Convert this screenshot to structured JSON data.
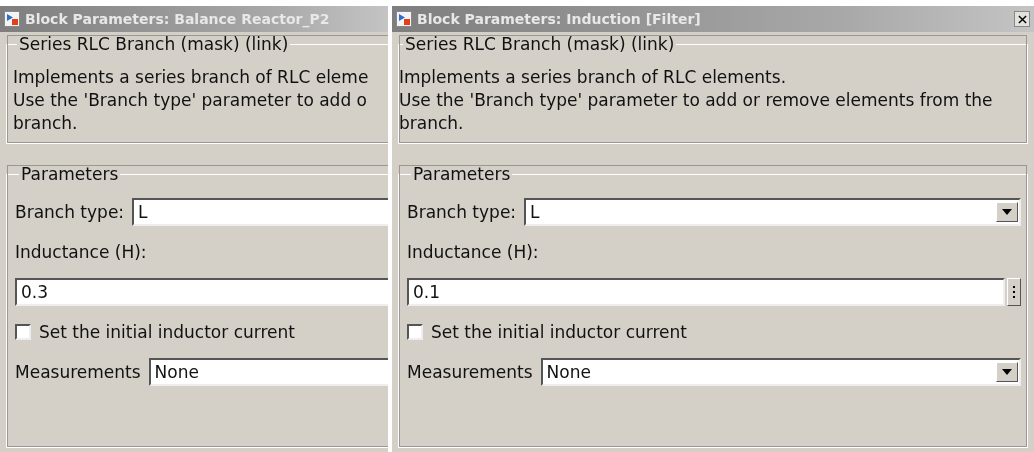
{
  "windows": [
    {
      "title": "Block Parameters: Balance Reactor_P2",
      "partly_covered": true,
      "closable": false,
      "mask_group": {
        "title": "Series RLC Branch (mask) (link)",
        "description": [
          "Implements a series branch of RLC eleme",
          "Use the 'Branch type' parameter to add o",
          "branch."
        ]
      },
      "parameters": {
        "title": "Parameters",
        "branch_type": {
          "label": "Branch type:",
          "value": "L"
        },
        "inductance": {
          "label": "Inductance (H):",
          "value": "0.3"
        },
        "initial_current": {
          "label": "Set the initial inductor current",
          "checked": false
        },
        "measurements": {
          "label": "Measurements",
          "value": "None"
        }
      }
    },
    {
      "title": "Block Parameters: Induction [Filter]",
      "partly_covered": false,
      "closable": true,
      "mask_group": {
        "title": "Series RLC Branch (mask) (link)",
        "description": [
          "Implements a series branch of RLC elements.",
          "Use the 'Branch type' parameter to add or remove elements from the",
          "branch."
        ]
      },
      "parameters": {
        "title": "Parameters",
        "branch_type": {
          "label": "Branch type:",
          "value": "L"
        },
        "inductance": {
          "label": "Inductance (H):",
          "value": "0.1"
        },
        "initial_current": {
          "label": "Set the initial inductor current",
          "checked": false
        },
        "measurements": {
          "label": "Measurements",
          "value": "None"
        }
      }
    }
  ]
}
